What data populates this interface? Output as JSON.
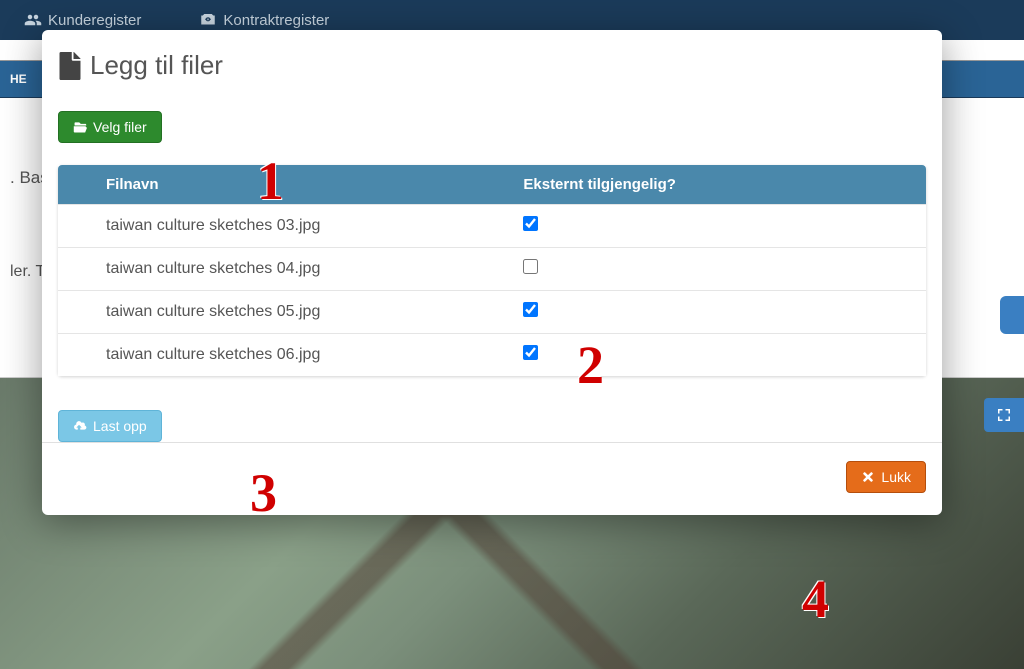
{
  "nav": {
    "item1": "Kunderegister",
    "item2": "Kontraktregister"
  },
  "bg": {
    "tab": "HE",
    "text1": ". Bas",
    "text2": "ler. T"
  },
  "modal": {
    "title": "Legg til filer",
    "select_files": "Velg filer",
    "upload": "Last opp",
    "close": "Lukk",
    "table": {
      "col_filename": "Filnavn",
      "col_external": "Eksternt tilgjengelig?",
      "rows": [
        {
          "name": "taiwan culture sketches 03.jpg",
          "checked": true
        },
        {
          "name": "taiwan culture sketches 04.jpg",
          "checked": false
        },
        {
          "name": "taiwan culture sketches 05.jpg",
          "checked": true
        },
        {
          "name": "taiwan culture sketches 06.jpg",
          "checked": true
        }
      ]
    }
  },
  "steps": {
    "s1": "1",
    "s2": "2",
    "s3": "3",
    "s4": "4"
  }
}
